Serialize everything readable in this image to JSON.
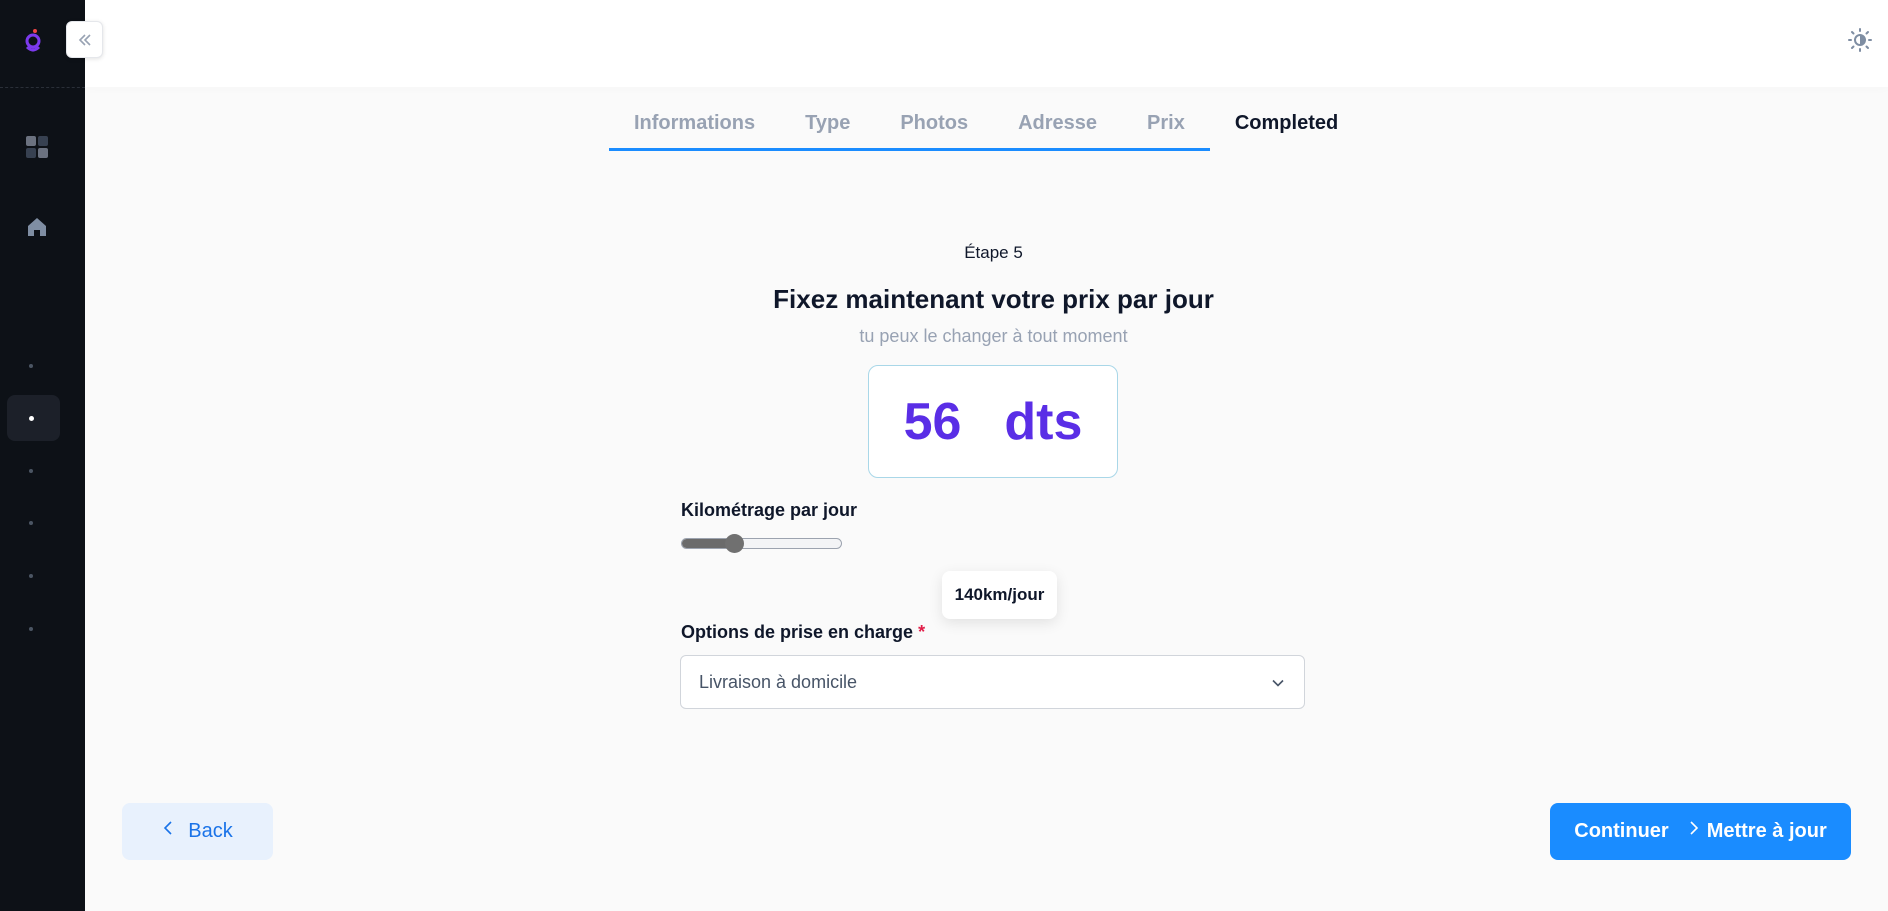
{
  "sidebar": {
    "icons": [
      "logo-icon",
      "dashboard-icon",
      "home-icon"
    ],
    "dot_items": 6,
    "active_index": 1
  },
  "header": {
    "theme_icon": "sun-icon",
    "avatar": "user-avatar"
  },
  "tabs": [
    {
      "label": "Informations",
      "state": "done"
    },
    {
      "label": "Type",
      "state": "done"
    },
    {
      "label": "Photos",
      "state": "done"
    },
    {
      "label": "Adresse",
      "state": "done"
    },
    {
      "label": "Prix",
      "state": "done"
    },
    {
      "label": "Completed",
      "state": "current"
    }
  ],
  "content": {
    "step": "Étape 5",
    "title": "Fixez maintenant votre prix par jour",
    "subtitle": "tu peux le changer à tout moment",
    "price_value": "56",
    "price_unit": "dts"
  },
  "mileage": {
    "label": "Kilométrage par jour",
    "slider_fraction": 0.31,
    "tooltip": "140km/jour"
  },
  "pickup": {
    "label": "Options de prise en charge",
    "required_mark": "*",
    "selected": "Livraison à domicile"
  },
  "footer": {
    "back_label": "Back",
    "continue_label": "Continuer",
    "update_label": "Mettre à jour"
  },
  "colors": {
    "accent": "#1a8cff",
    "price": "#5a2ee6",
    "sidebar": "#0d1117"
  }
}
